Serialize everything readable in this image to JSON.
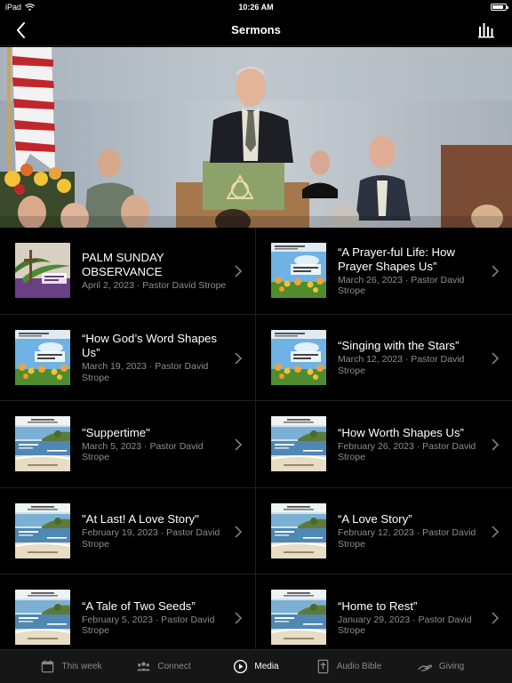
{
  "status_bar": {
    "device": "iPad",
    "time": "10:26 AM"
  },
  "header": {
    "title": "Sermons"
  },
  "sermons": [
    {
      "title": "PALM SUNDAY OBSERVANCE",
      "meta": "April 2, 2023 · Pastor David Strope",
      "thumb": "palm"
    },
    {
      "title": "“A Prayer-ful Life: How Prayer Shapes Us”",
      "meta": "March 26, 2023 · Pastor David Strope",
      "thumb": "flowers"
    },
    {
      "title": "“How God’s Word Shapes Us”",
      "meta": "March 19, 2023 · Pastor David Strope",
      "thumb": "flowers"
    },
    {
      "title": "“Singing with the Stars”",
      "meta": "March 12, 2023 · Pastor David Strope",
      "thumb": "flowers"
    },
    {
      "title": "\"Suppertime\"",
      "meta": "March 5, 2023 · Pastor David Strope",
      "thumb": "beach"
    },
    {
      "title": "“How Worth Shapes Us”",
      "meta": "February 26, 2023 · Pastor David Strope",
      "thumb": "beach"
    },
    {
      "title": "\"At Last!  A Love Story\"",
      "meta": "February 19, 2023 · Pastor David Strope",
      "thumb": "beach"
    },
    {
      "title": "“A Love Story”",
      "meta": "February 12, 2023 · Pastor David Strope",
      "thumb": "beach"
    },
    {
      "title": "“A Tale of Two Seeds”",
      "meta": "February 5, 2023 · Pastor David Strope",
      "thumb": "beach"
    },
    {
      "title": "“Home to Rest”",
      "meta": "January 29, 2023 · Pastor David Strope",
      "thumb": "beach"
    }
  ],
  "tabs": [
    {
      "label": "This week",
      "icon": "calendar-icon",
      "active": false
    },
    {
      "label": "Connect",
      "icon": "people-icon",
      "active": false
    },
    {
      "label": "Media",
      "icon": "play-icon",
      "active": true
    },
    {
      "label": "Audio Bible",
      "icon": "bible-icon",
      "active": false
    },
    {
      "label": "Giving",
      "icon": "giving-icon",
      "active": false
    }
  ]
}
